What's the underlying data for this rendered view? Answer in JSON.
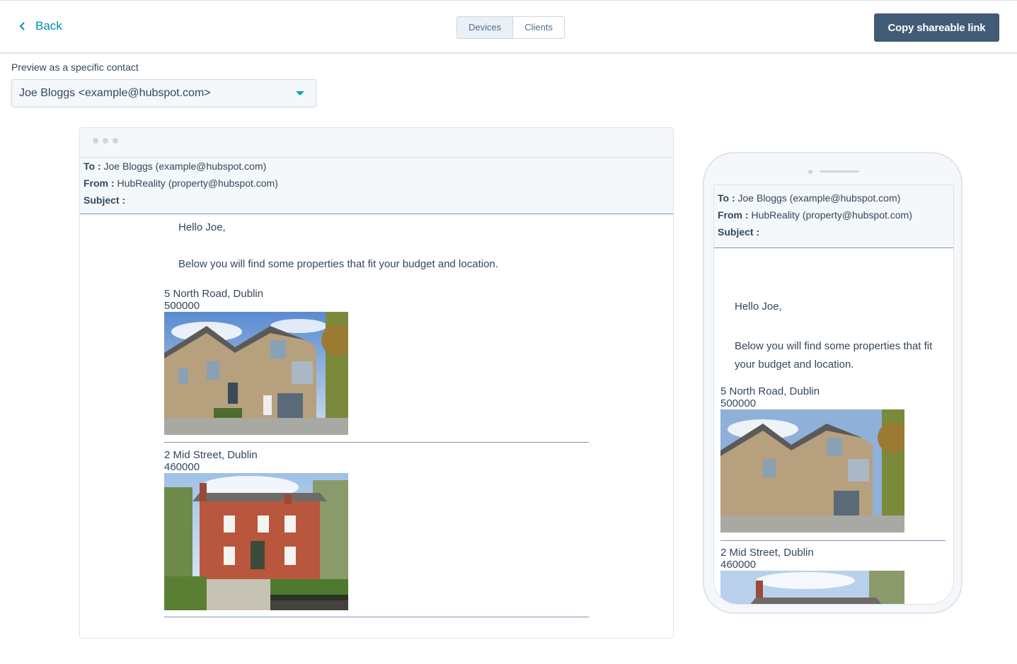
{
  "header": {
    "back_label": "Back",
    "tabs": [
      {
        "label": "Devices",
        "active": true
      },
      {
        "label": "Clients",
        "active": false
      }
    ],
    "copy_link_label": "Copy shareable link"
  },
  "contact": {
    "label": "Preview as a specific contact",
    "selected": "Joe Bloggs <example@hubspot.com>"
  },
  "email": {
    "to_label": "To :",
    "to_value": "Joe Bloggs (example@hubspot.com)",
    "from_label": "From :",
    "from_value": "HubReality (property@hubspot.com)",
    "subject_label": "Subject :",
    "subject_value": "",
    "greeting": "Hello Joe,",
    "intro": "Below you will find some properties that fit your budget and location.",
    "properties": [
      {
        "address": "5 North Road, Dublin",
        "price": "500000"
      },
      {
        "address": "2 Mid Street, Dublin",
        "price": "460000"
      }
    ]
  },
  "colors": {
    "accent": "#0091ae",
    "primary_button": "#425b76",
    "text": "#33475b",
    "border": "#dfe3eb"
  }
}
